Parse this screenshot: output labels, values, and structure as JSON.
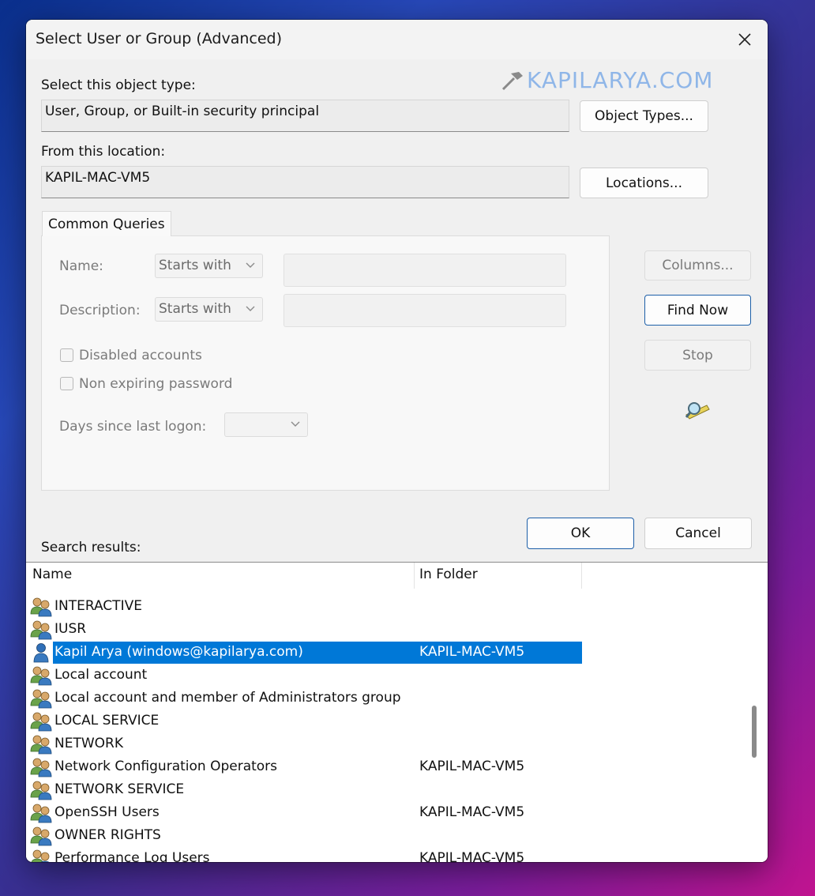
{
  "dialog": {
    "title": "Select User or Group (Advanced)",
    "watermark": "KAPILARYA.COM"
  },
  "object_type": {
    "label": "Select this object type:",
    "value": "User, Group, or Built-in security principal",
    "button": "Object Types..."
  },
  "location": {
    "label": "From this location:",
    "value": "KAPIL-MAC-VM5",
    "button": "Locations..."
  },
  "common_queries": {
    "tab_label": "Common Queries",
    "name_label": "Name:",
    "name_mode": "Starts with",
    "description_label": "Description:",
    "description_mode": "Starts with",
    "disabled_accounts": "Disabled accounts",
    "non_expiring_password": "Non expiring password",
    "days_since_logon_label": "Days since last logon:"
  },
  "side_buttons": {
    "columns": "Columns...",
    "find_now": "Find Now",
    "stop": "Stop"
  },
  "footer": {
    "ok": "OK",
    "cancel": "Cancel"
  },
  "results": {
    "label": "Search results:",
    "columns": [
      "Name",
      "In Folder"
    ],
    "rows": [
      {
        "name": "INTERACTIVE",
        "folder": "",
        "type": "group",
        "selected": false
      },
      {
        "name": "IUSR",
        "folder": "",
        "type": "group",
        "selected": false
      },
      {
        "name": "Kapil Arya (windows@kapilarya.com)",
        "folder": "KAPIL-MAC-VM5",
        "type": "user",
        "selected": true
      },
      {
        "name": "Local account",
        "folder": "",
        "type": "group",
        "selected": false
      },
      {
        "name": "Local account and member of Administrators group",
        "folder": "",
        "type": "group",
        "selected": false
      },
      {
        "name": "LOCAL SERVICE",
        "folder": "",
        "type": "group",
        "selected": false
      },
      {
        "name": "NETWORK",
        "folder": "",
        "type": "group",
        "selected": false
      },
      {
        "name": "Network Configuration Operators",
        "folder": "KAPIL-MAC-VM5",
        "type": "group",
        "selected": false
      },
      {
        "name": "NETWORK SERVICE",
        "folder": "",
        "type": "group",
        "selected": false
      },
      {
        "name": "OpenSSH Users",
        "folder": "KAPIL-MAC-VM5",
        "type": "group",
        "selected": false
      },
      {
        "name": "OWNER RIGHTS",
        "folder": "",
        "type": "group",
        "selected": false
      },
      {
        "name": "Performance Log Users",
        "folder": "KAPIL-MAC-VM5",
        "type": "group",
        "selected": false
      }
    ]
  },
  "colors": {
    "selection": "#0078d7",
    "primary_border": "#1d5fa8",
    "dialog_bg": "#f0f0f0"
  },
  "icons": {
    "close": "close-icon",
    "search_tool": "magnifier-key-icon",
    "group": "group-users-icon",
    "user": "user-icon"
  }
}
